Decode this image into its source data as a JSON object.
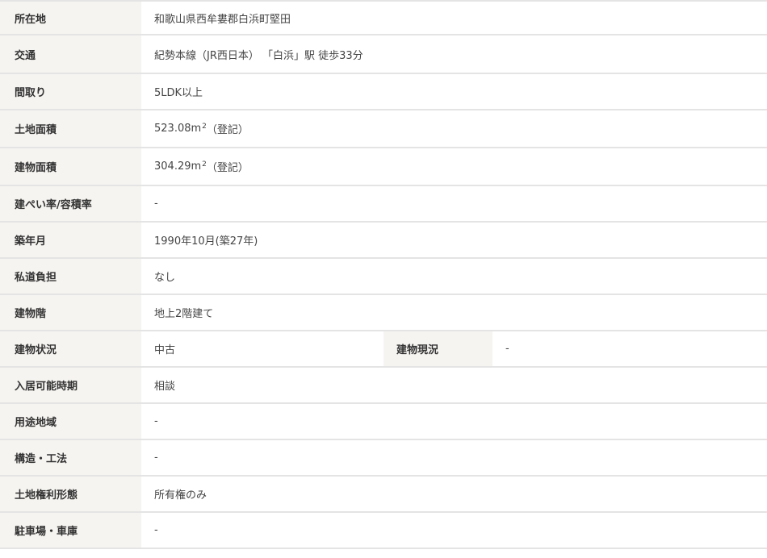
{
  "rows": [
    {
      "label": "所在地",
      "value": "和歌山県西牟婁郡白浜町堅田"
    },
    {
      "label": "交通",
      "value": "紀勢本線（JR西日本） 「白浜」駅 徒歩33分"
    },
    {
      "label": "間取り",
      "value": "5LDK以上"
    },
    {
      "label": "土地面積",
      "value_main": "523.08m",
      "value_sup": "2",
      "value_tail": "（登記）"
    },
    {
      "label": "建物面積",
      "value_main": "304.29m",
      "value_sup": "2",
      "value_tail": "（登記）"
    },
    {
      "label": "建ぺい率/容積率",
      "value": "-"
    },
    {
      "label": "築年月",
      "value": "1990年10月(築27年)"
    },
    {
      "label": "私道負担",
      "value": "なし"
    },
    {
      "label": "建物階",
      "value": "地上2階建て"
    },
    {
      "label": "建物状況",
      "value": "中古",
      "label2": "建物現況",
      "value2": "-"
    },
    {
      "label": "入居可能時期",
      "value": "相談"
    },
    {
      "label": "用途地域",
      "value": "-"
    },
    {
      "label": "構造・工法",
      "value": "-"
    },
    {
      "label": "土地権利形態",
      "value": "所有権のみ"
    },
    {
      "label": "駐車場・車庫",
      "value": "-"
    }
  ]
}
